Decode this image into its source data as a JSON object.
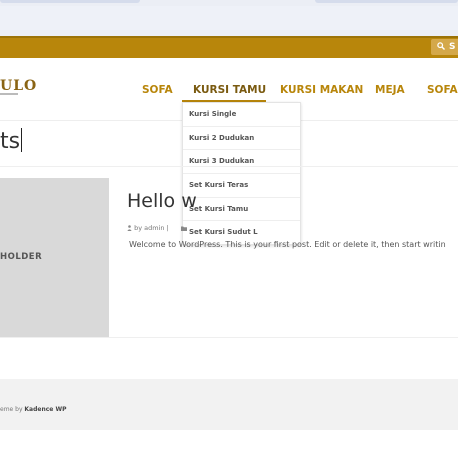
{
  "topbar": {
    "search_label": "S",
    "search_icon": "search-icon"
  },
  "header": {
    "logo_text": "ULO",
    "nav": [
      "SOFA",
      "KURSI TAMU",
      "KURSI MAKAN",
      "MEJA",
      "SOFAK"
    ],
    "active_nav": "KURSI TAMU"
  },
  "dropdown": {
    "items": [
      "Kursi Single",
      "Kursi 2 Dudukan",
      "Kursi 3 Dudukan",
      "Set Kursi Teras",
      "Set Kursi Tamu",
      "Set Kursi Sudut L"
    ]
  },
  "page": {
    "title": "ts"
  },
  "post": {
    "image_label": "HOLDER",
    "title": "Hello w",
    "author": "by admin |",
    "excerpt": "Welcome to WordPress. This is your first post. Edit or delete it, then start writin"
  },
  "footer": {
    "prefix": "eme by ",
    "link": "Kadence WP"
  },
  "colors": {
    "brand_gold": "#b8860b",
    "dark_gold": "#7a5a10"
  }
}
